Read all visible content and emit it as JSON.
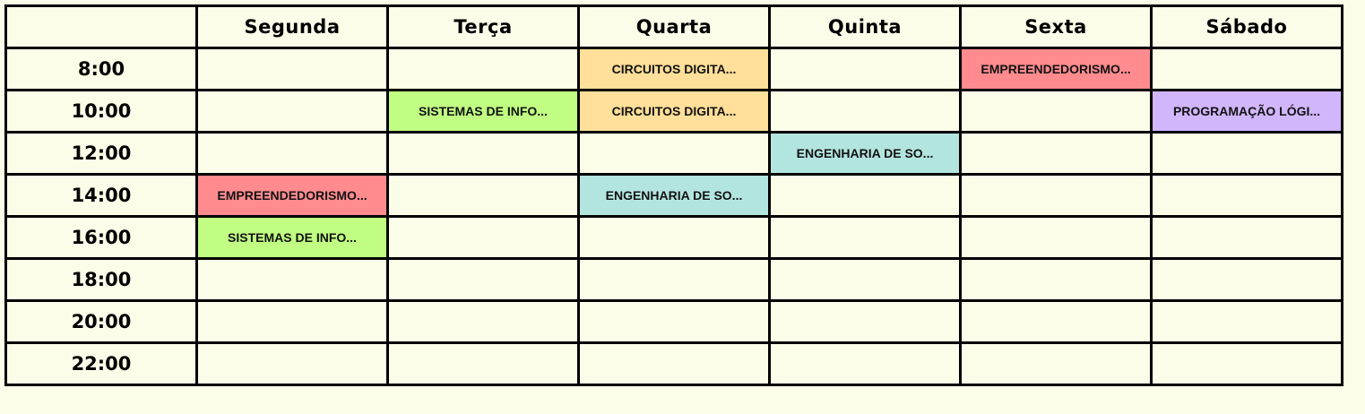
{
  "days": [
    "Segunda",
    "Terça",
    "Quarta",
    "Quinta",
    "Sexta",
    "Sábado"
  ],
  "times": [
    "8:00",
    "10:00",
    "12:00",
    "14:00",
    "16:00",
    "18:00",
    "20:00",
    "22:00"
  ],
  "colors": {
    "background": "#fcfde8",
    "orange": "#ffdf99",
    "red": "#ff8b8f",
    "green": "#c0fd82",
    "purple": "#d1b6fc",
    "teal": "#b3e5df"
  },
  "slots": [
    {
      "time": 0,
      "day": 2,
      "label": "CIRCUITOS DIGITA...",
      "color": "#ffdf99"
    },
    {
      "time": 0,
      "day": 4,
      "label": "EMPREENDEDORISMO...",
      "color": "#ff8b8f"
    },
    {
      "time": 1,
      "day": 1,
      "label": "SISTEMAS DE INFO...",
      "color": "#c0fd82"
    },
    {
      "time": 1,
      "day": 2,
      "label": "CIRCUITOS DIGITA...",
      "color": "#ffdf99"
    },
    {
      "time": 1,
      "day": 5,
      "label": "PROGRAMAÇÃO LÓGI...",
      "color": "#d1b6fc"
    },
    {
      "time": 2,
      "day": 3,
      "label": "ENGENHARIA DE SO...",
      "color": "#b3e5df"
    },
    {
      "time": 3,
      "day": 0,
      "label": "EMPREENDEDORISMO...",
      "color": "#ff8b8f"
    },
    {
      "time": 3,
      "day": 2,
      "label": "ENGENHARIA DE SO...",
      "color": "#b3e5df"
    },
    {
      "time": 4,
      "day": 0,
      "label": "SISTEMAS DE INFO...",
      "color": "#c0fd82"
    }
  ]
}
